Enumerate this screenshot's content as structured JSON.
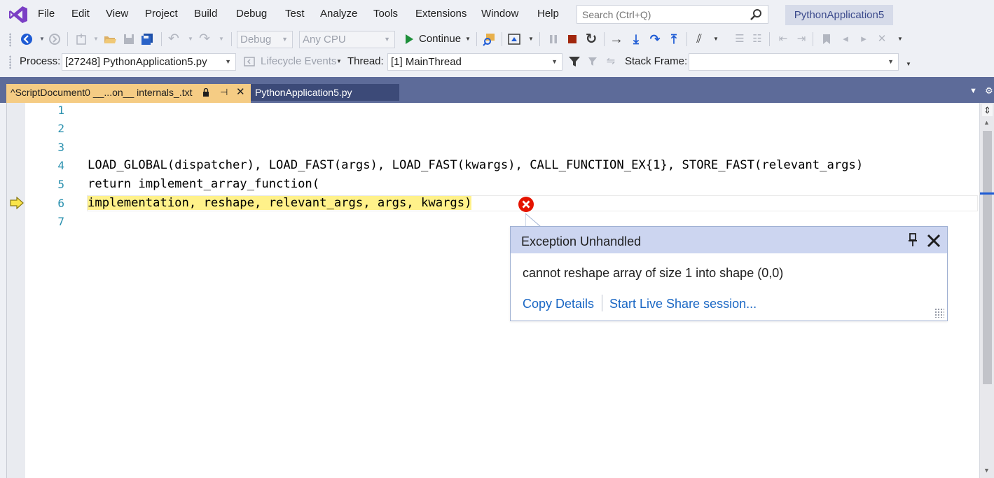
{
  "app": {
    "solution_name": "PythonApplication5"
  },
  "menu": [
    "File",
    "Edit",
    "View",
    "Project",
    "Build",
    "Debug",
    "Test",
    "Analyze",
    "Tools",
    "Extensions",
    "Window",
    "Help"
  ],
  "search": {
    "placeholder": "Search (Ctrl+Q)"
  },
  "toolbar": {
    "config": "Debug",
    "platform": "Any CPU",
    "continue_label": "Continue",
    "process_label": "Process:",
    "process_value": "[27248] PythonApplication5.py",
    "lifecycle_label": "Lifecycle Events",
    "thread_label": "Thread:",
    "thread_value": "[1] MainThread",
    "stackframe_label": "Stack Frame:",
    "stackframe_value": ""
  },
  "tabs": {
    "active": "^ScriptDocument0 __...on__ internals_.txt",
    "inactive": "PythonApplication5.py"
  },
  "editor": {
    "line_numbers": [
      "1",
      "2",
      "3",
      "4",
      "5",
      "6",
      "7"
    ],
    "lines": [
      "",
      "",
      "",
      "LOAD_GLOBAL(dispatcher), LOAD_FAST(args), LOAD_FAST(kwargs), CALL_FUNCTION_EX{1}, STORE_FAST(relevant_args)",
      "return implement_array_function(",
      "implementation, reshape, relevant_args, args, kwargs)",
      ""
    ],
    "current_line": 6
  },
  "exception": {
    "title": "Exception Unhandled",
    "message": "cannot reshape array of size 1 into shape (0,0)",
    "link_copy": "Copy Details",
    "link_liveshare": "Start Live Share session..."
  },
  "colors": {
    "accent": "#5d6b99",
    "active_tab": "#f5cc84",
    "line_highlight": "#fff18a",
    "error": "#e51400",
    "link": "#1a67c4"
  }
}
